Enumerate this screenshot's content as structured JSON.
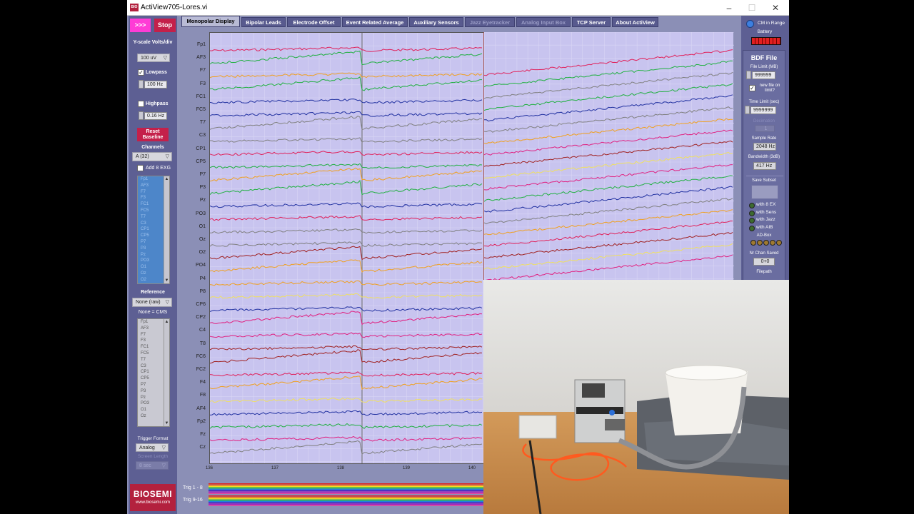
{
  "window": {
    "title": "ActiView705-Lores.vi",
    "icon_text": "BIO"
  },
  "top_buttons": {
    "go": ">>>",
    "stop": "Stop"
  },
  "left": {
    "yscale_label": "Y-scale Volts/div",
    "yscale_value": "100 uV",
    "lowpass_label": "Lowpass",
    "lowpass_checked": "✓",
    "lowpass_value": "100",
    "lowpass_unit": "Hz",
    "highpass_label": "Highpass",
    "highpass_value": "0.16",
    "highpass_unit": "Hz",
    "reset_label": "Reset Baseline",
    "channels_label": "Channels",
    "channels_value": "A (32)",
    "add_exg_label": "Add 8 EXG",
    "channel_list": [
      "Fp1",
      "AF3",
      "F7",
      "F3",
      "FC1",
      "FC5",
      "T7",
      "C3",
      "CP1",
      "CP5",
      "P7",
      "P3",
      "Pz",
      "PO3",
      "O1",
      "Oz",
      "O2",
      "PO4",
      "P4"
    ],
    "reference_label": "Reference",
    "reference_value": "None (raw)",
    "reference_note": "None = CMS",
    "ref_list": [
      "Fp1",
      "AF3",
      "F7",
      "F3",
      "FC1",
      "FC5",
      "T7",
      "C3",
      "CP1",
      "CP5",
      "P7",
      "P3",
      "Pz",
      "PO3",
      "O1",
      "Oz"
    ],
    "trigger_format_label": "Trigger Format",
    "trigger_format_value": "Analog",
    "screen_length_label": "Screen Length",
    "screen_length_value": "8 sec",
    "logo": "BIOSEMI",
    "url": "www.biosemi.com"
  },
  "tabs": [
    {
      "label": "Monopolar Display"
    },
    {
      "label": "Bipolar Leads"
    },
    {
      "label": "Electrode Offset"
    },
    {
      "label": "Event Related Average"
    },
    {
      "label": "Auxiliary Sensors"
    },
    {
      "label": "Jazz Eyetracker"
    },
    {
      "label": "Analog Input Box"
    },
    {
      "label": "TCP Server"
    },
    {
      "label": "About ActiView"
    }
  ],
  "channels": [
    "Fp1",
    "AF3",
    "F7",
    "F3",
    "FC1",
    "FC5",
    "T7",
    "C3",
    "CP1",
    "CP5",
    "P7",
    "P3",
    "Pz",
    "PO3",
    "O1",
    "Oz",
    "O2",
    "PO4",
    "P4",
    "P8",
    "CP6",
    "CP2",
    "C4",
    "T8",
    "FC6",
    "FC2",
    "F4",
    "F8",
    "AF4",
    "Fp2",
    "Fz",
    "Cz"
  ],
  "trace_colors": [
    "#e0205a",
    "#20b040",
    "#f0a020",
    "#20b040",
    "#2030a0",
    "#2030a0",
    "#808080",
    "#808080",
    "#e0205a",
    "#20b040",
    "#f0a020",
    "#20b040",
    "#2030a0",
    "#e0205a",
    "#808080",
    "#808080",
    "#a02020",
    "#f0a020",
    "#f0a020",
    "#f0e060",
    "#2030a0",
    "#e02080",
    "#e02080",
    "#a02020",
    "#a02020",
    "#e0205a",
    "#f0a020",
    "#f0e060",
    "#2030a0",
    "#20b040",
    "#e02080",
    "#808080"
  ],
  "x_ticks": [
    "136",
    "137",
    "138",
    "139",
    "140"
  ],
  "trig": {
    "row1": "Trig 1 - 8",
    "row2": "Trig 9-16"
  },
  "right": {
    "cm_label": "CM in Range",
    "battery_label": "Battery",
    "bdf_title": "BDF File",
    "file_limit_label": "File Limit (MB)",
    "file_limit_value": "999999",
    "new_file_label": "new file on limit?",
    "time_limit_label": "Time Limit (sec)",
    "time_limit_value": "9999999",
    "decimation_label": "Decimation",
    "decimation_value": "1",
    "sample_rate_label": "Sample Rate",
    "sample_rate_value": "2048",
    "sample_rate_unit": "Hz",
    "bandwidth_label": "Bandwidth (3dB)",
    "bandwidth_value": "417",
    "bandwidth_unit": "Hz",
    "save_subset_label": "Save Subset",
    "with_items": [
      "with 8 EX",
      "with Sens",
      "with Jazz",
      "with AIB"
    ],
    "aibox_label": "AD-Box",
    "nr_chan_label": "Nr Chan Saved",
    "nr_chan_value": "0+0",
    "filepath_label": "Filepath"
  }
}
